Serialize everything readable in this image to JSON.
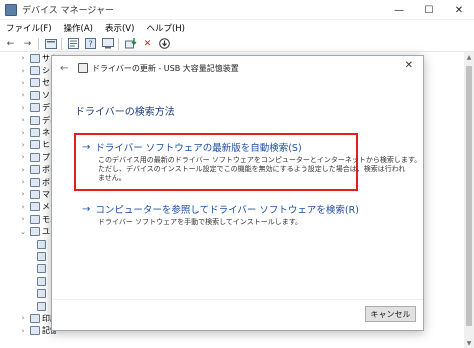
{
  "window": {
    "title": "デバイス マネージャー",
    "minimize": "—",
    "maximize": "☐",
    "close": "✕"
  },
  "menu": {
    "items": [
      "ファイル(F)",
      "操作(A)",
      "表示(V)",
      "ヘルプ(H)"
    ]
  },
  "toolbar": {
    "back": "←",
    "forward": "→",
    "remove_icon": "✕",
    "download_icon": "⊕",
    "remove_color": "#d01818"
  },
  "tree": {
    "items": [
      {
        "label": "サウ",
        "chev": "›"
      },
      {
        "label": "シス",
        "chev": "›"
      },
      {
        "label": "セン",
        "chev": "›"
      },
      {
        "label": "ソフ",
        "chev": "›"
      },
      {
        "label": "ディ",
        "chev": "›"
      },
      {
        "label": "ディ",
        "chev": "›"
      },
      {
        "label": "ネッ",
        "chev": "›"
      },
      {
        "label": "ヒュ",
        "chev": "›"
      },
      {
        "label": "プロ",
        "chev": "›"
      },
      {
        "label": "ポー",
        "chev": "›"
      },
      {
        "label": "ボー",
        "chev": "›"
      },
      {
        "label": "マウ",
        "chev": "›"
      },
      {
        "label": "メモ",
        "chev": "›"
      },
      {
        "label": "モニ",
        "chev": "›"
      },
      {
        "label": "ユニ",
        "chev": "⌄"
      },
      {
        "label": "",
        "chev": ""
      },
      {
        "label": "",
        "chev": ""
      },
      {
        "label": "",
        "chev": ""
      },
      {
        "label": "",
        "chev": ""
      },
      {
        "label": "",
        "chev": ""
      },
      {
        "label": "",
        "chev": ""
      },
      {
        "label": "印刷",
        "chev": "›"
      },
      {
        "label": "記憶",
        "chev": "›"
      }
    ]
  },
  "dialog": {
    "back": "←",
    "title": "ドライバーの更新 - USB 大容量記憶装置",
    "close": "✕",
    "heading": "ドライバーの検索方法",
    "option1": {
      "arrow": "→",
      "title": "ドライバー ソフトウェアの最新版を自動検索(S)",
      "desc1": "このデバイス用の最新のドライバー ソフトウェアをコンピューターとインターネットから検索します。",
      "desc2": "ただし、デバイスのインストール設定でこの機能を無効にするよう設定した場合は、検索は行われ",
      "desc3": "ません。"
    },
    "option2": {
      "arrow": "→",
      "title": "コンピューターを参照してドライバー ソフトウェアを検索(R)",
      "desc1": "ドライバー ソフトウェアを手動で検索してインストールします。"
    },
    "cancel_label": "キャンセル",
    "highlight_color": "#e02020",
    "link_color": "#1e4fa8"
  }
}
